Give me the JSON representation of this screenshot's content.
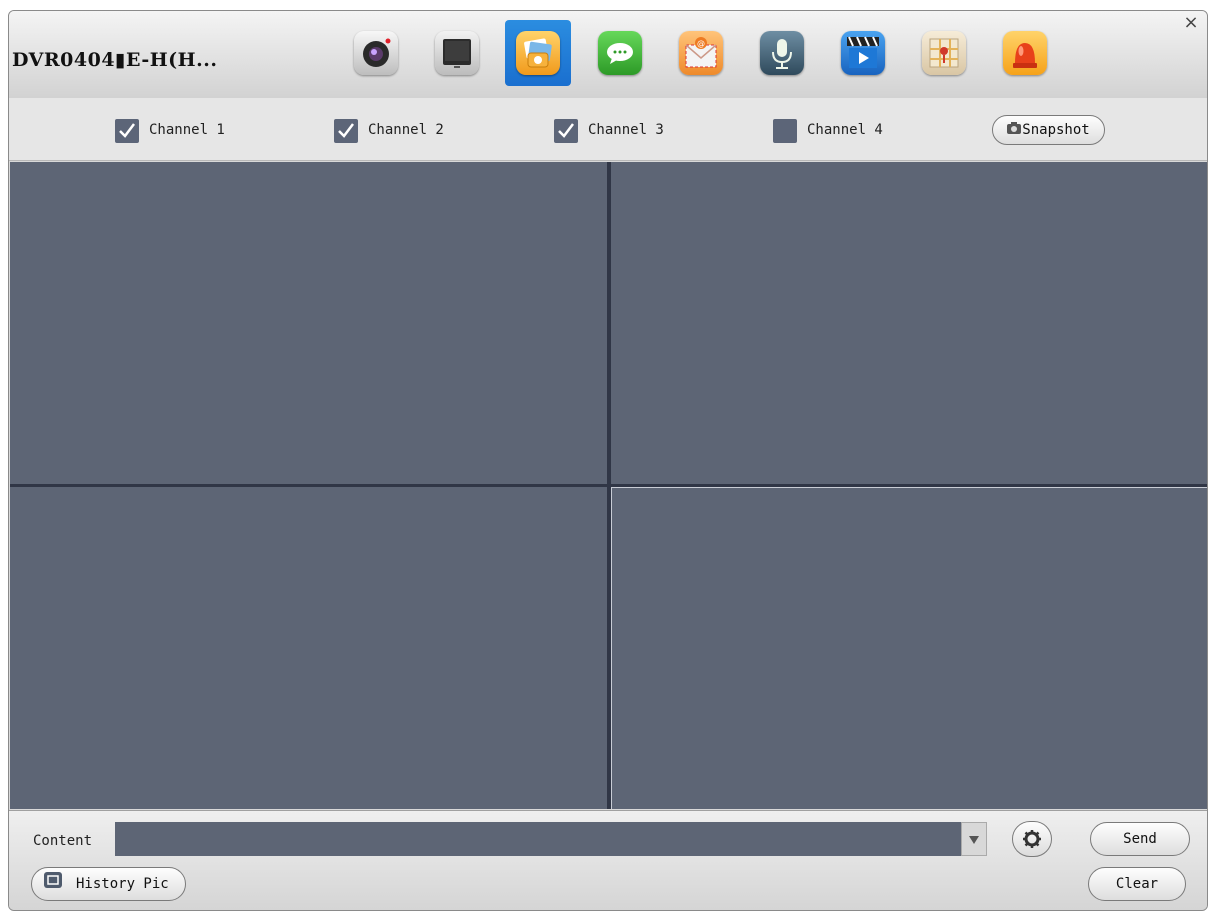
{
  "window": {
    "title": "DVR0404▮E-H(H...",
    "close_glyph": "×"
  },
  "toolbar": {
    "tools": [
      {
        "icon": "camera-lens-icon",
        "color": "#3a3a3a"
      },
      {
        "icon": "monitor-icon",
        "color": "#333333"
      },
      {
        "icon": "snapshot-photos-icon",
        "color": "#f2a52b",
        "active": true
      },
      {
        "icon": "chat-bubble-icon",
        "color": "#3fb13c"
      },
      {
        "icon": "email-icon",
        "color": "#f19b3a"
      },
      {
        "icon": "microphone-icon",
        "color": "#3d6076"
      },
      {
        "icon": "video-clapper-icon",
        "color": "#2a7ed8"
      },
      {
        "icon": "map-pin-icon",
        "color": "#e8d8b6"
      },
      {
        "icon": "alarm-siren-icon",
        "color": "#e8541e"
      }
    ]
  },
  "channels": [
    {
      "label": "Channel 1",
      "checked": true
    },
    {
      "label": "Channel 2",
      "checked": true
    },
    {
      "label": "Channel 3",
      "checked": true
    },
    {
      "label": "Channel 4",
      "checked": false
    }
  ],
  "snapshot_button": {
    "label": "Snapshot",
    "icon": "camera-icon"
  },
  "bottom": {
    "content_label": "Content",
    "content_value": "",
    "send_label": "Send",
    "clear_label": "Clear",
    "history_label": "History Pic",
    "settings_icon": "gear-icon"
  },
  "colors": {
    "video_cell": "#5d6575",
    "accent_active": "#1a6fcf"
  }
}
